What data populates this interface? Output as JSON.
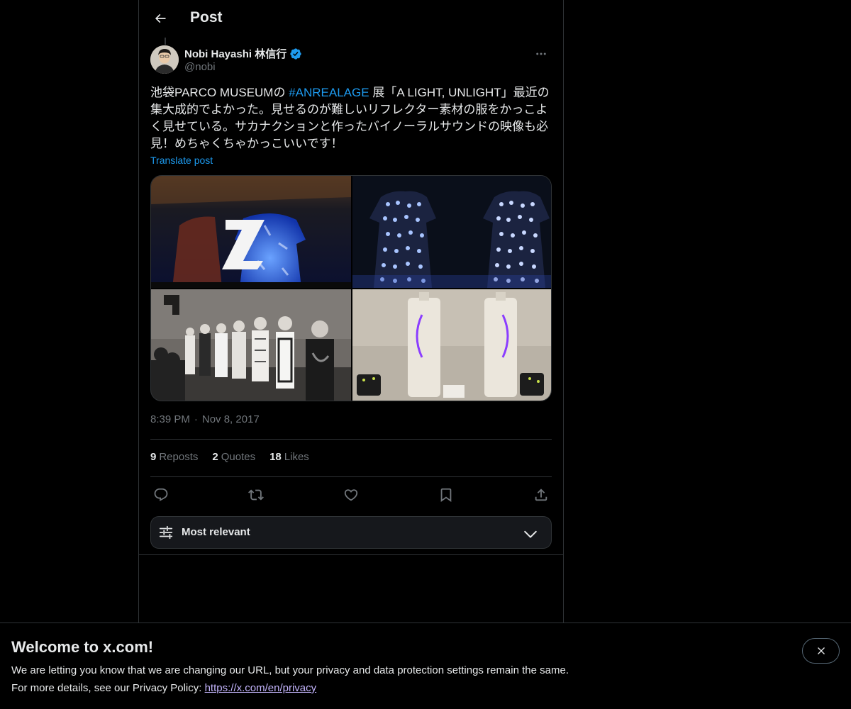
{
  "header": {
    "title": "Post"
  },
  "author": {
    "name": "Nobi Hayashi 林信行",
    "handle": "@nobi"
  },
  "post": {
    "text_before": "池袋PARCO MUSEUMの ",
    "hashtag": "#ANREALAGE",
    "text_after": " 展「A LIGHT, UNLIGHT」最近の集大成的でよかった。見せるのが難しいリフレクター素材の服をかっこよく見せている。サカナクションと作ったバイノーラルサウンドの映像も必見！めちゃくちゃかっこいいです！",
    "translate_label": "Translate post",
    "time": "8:39 PM",
    "separator": "·",
    "date": "Nov 8, 2017"
  },
  "stats": {
    "reposts": {
      "count": "9",
      "label": "Reposts"
    },
    "quotes": {
      "count": "2",
      "label": "Quotes"
    },
    "likes": {
      "count": "18",
      "label": "Likes"
    }
  },
  "actions": [
    "reply-icon",
    "repost-icon",
    "like-icon",
    "bookmark-icon",
    "share-icon"
  ],
  "sort": {
    "label": "Most relevant"
  },
  "banner": {
    "title": "Welcome to x.com!",
    "line1": "We are letting you know that we are changing our URL, but your privacy and data protection settings remain the same.",
    "line2_prefix": "For more details, see our Privacy Policy: ",
    "link": "https://x.com/en/privacy"
  },
  "colors": {
    "background": "#000000",
    "text_primary": "#e7e9ea",
    "text_secondary": "#71767b",
    "accent": "#1d9bf0",
    "border": "#2f3336",
    "verified": "#1d9bf0"
  }
}
